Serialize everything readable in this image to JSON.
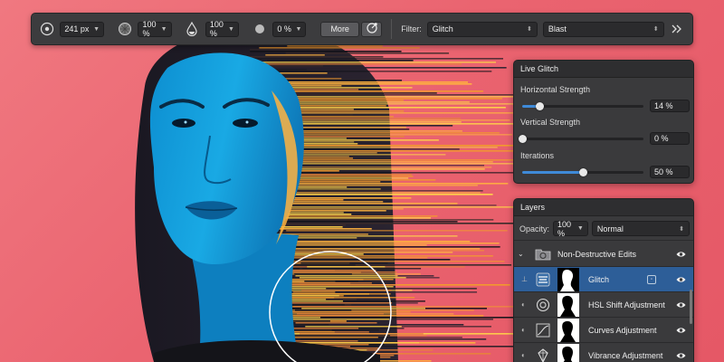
{
  "colors": {
    "background": "#ea6470",
    "panel": "#3a3a3c",
    "accent": "#3f8ad8",
    "selected_row": "#2d5e98"
  },
  "toolbar": {
    "width_value": "241 px",
    "hardness_value": "100 %",
    "opacity_value": "100 %",
    "flow_value": "0 %",
    "more_label": "More",
    "filter_label": "Filter:",
    "filter_value": "Glitch",
    "mode_value": "Blast",
    "icons": [
      "brush-size-icon",
      "hardness-icon",
      "opacity-drop-icon",
      "flow-dot-icon",
      "target-brush-icon",
      "expand-chevron-icon"
    ]
  },
  "live_glitch": {
    "title": "Live Glitch",
    "sliders": [
      {
        "label": "Horizontal Strength",
        "value_text": "14 %",
        "fraction": 0.14
      },
      {
        "label": "Vertical Strength",
        "value_text": "0 %",
        "fraction": 0.0
      },
      {
        "label": "Iterations",
        "value_text": "50 %",
        "fraction": 0.5
      }
    ]
  },
  "layers": {
    "title": "Layers",
    "opacity_label": "Opacity:",
    "opacity_value": "100 %",
    "blend_mode": "Normal",
    "items": [
      {
        "name": "Non-Destructive Edits",
        "icon": "folder-icon",
        "selected": false
      },
      {
        "name": "Glitch",
        "icon": "glitch-filter-icon",
        "selected": true
      },
      {
        "name": "HSL Shift Adjustment",
        "icon": "hsl-icon",
        "selected": false
      },
      {
        "name": "Curves Adjustment",
        "icon": "curves-icon",
        "selected": false
      },
      {
        "name": "Vibrance Adjustment",
        "icon": "vibrance-icon",
        "selected": false
      }
    ]
  }
}
